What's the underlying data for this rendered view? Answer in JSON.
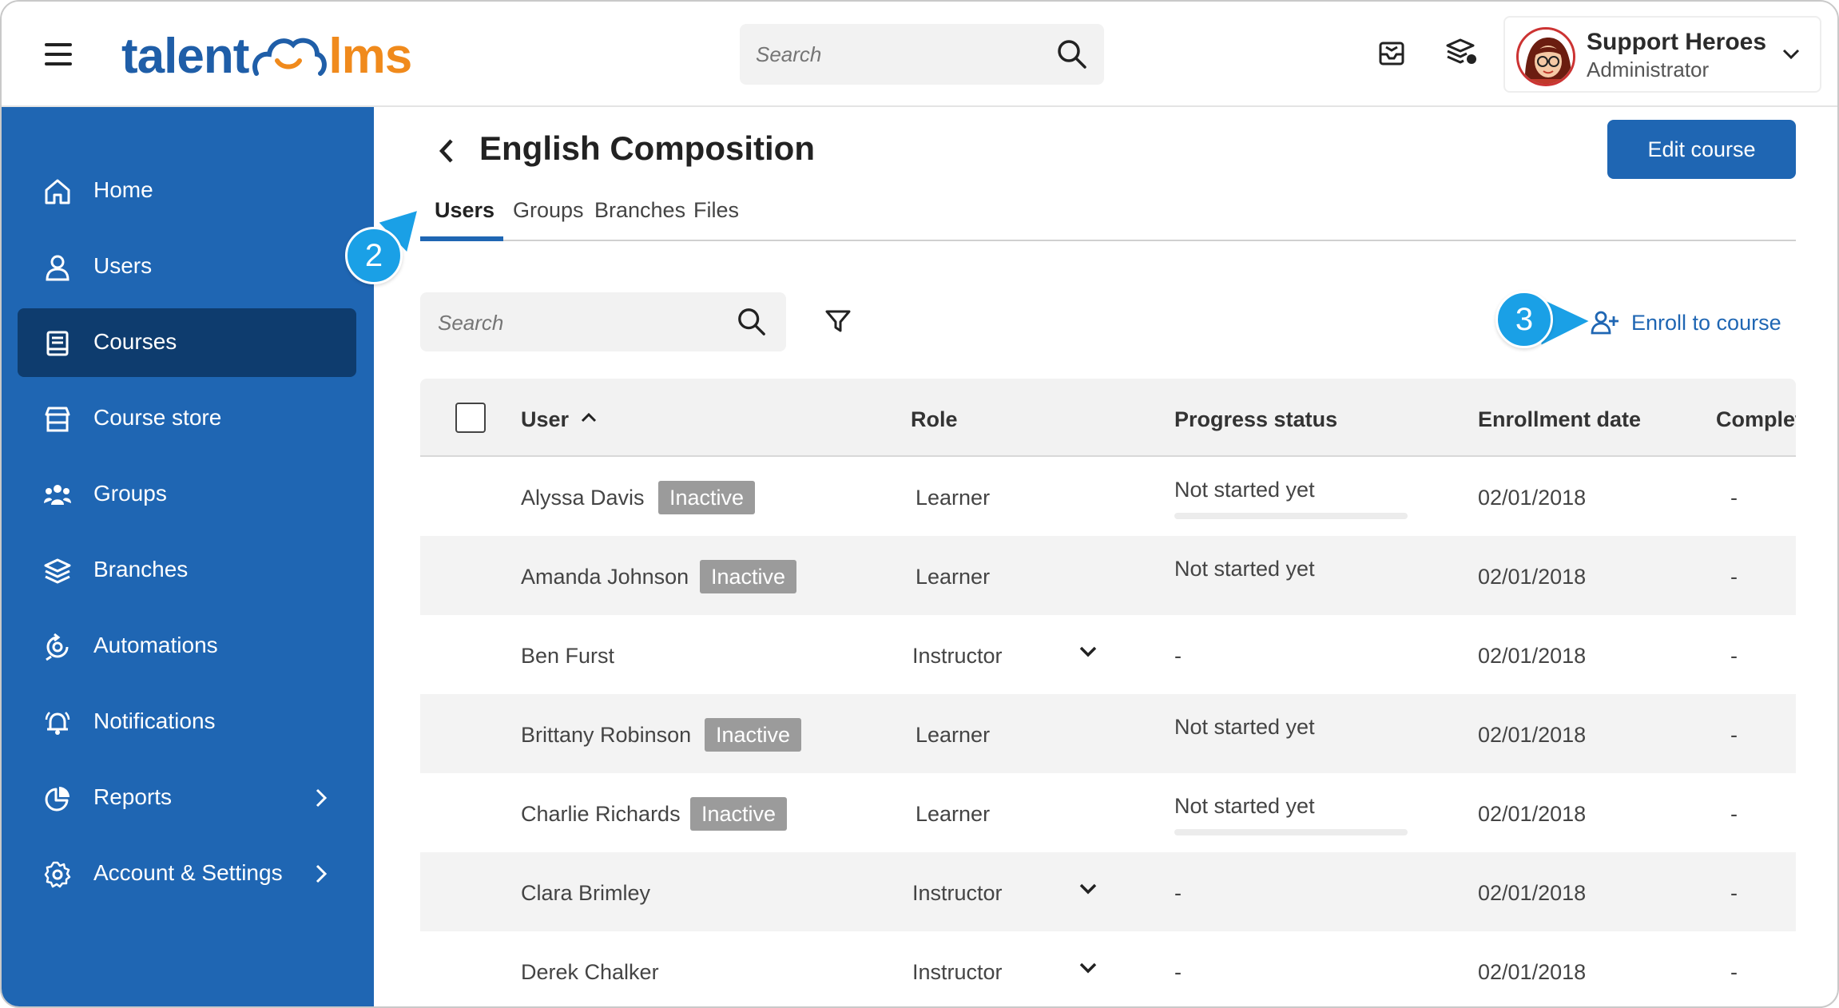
{
  "header": {
    "logo_left": "talent",
    "logo_right": "lms",
    "search_placeholder": "Search",
    "user_name": "Support Heroes",
    "user_role": "Administrator"
  },
  "sidebar": {
    "items": [
      {
        "label": "Home",
        "icon": "home-icon"
      },
      {
        "label": "Users",
        "icon": "user-icon"
      },
      {
        "label": "Courses",
        "icon": "book-icon",
        "active": true
      },
      {
        "label": "Course store",
        "icon": "store-icon"
      },
      {
        "label": "Groups",
        "icon": "groups-icon"
      },
      {
        "label": "Branches",
        "icon": "layers-icon"
      },
      {
        "label": "Automations",
        "icon": "automation-icon"
      },
      {
        "label": "Notifications",
        "icon": "bell-icon"
      },
      {
        "label": "Reports",
        "icon": "pie-chart-icon",
        "has_arrow": true
      },
      {
        "label": "Account & Settings",
        "icon": "gear-icon",
        "has_arrow": true
      }
    ]
  },
  "page": {
    "title": "English Composition",
    "edit_button": "Edit course",
    "tabs": [
      "Users",
      "Groups",
      "Branches",
      "Files"
    ],
    "active_tab": "Users",
    "search_placeholder": "Search",
    "enroll_label": "Enroll to course",
    "callouts": [
      "2",
      "3"
    ]
  },
  "table": {
    "columns": [
      "User",
      "Role",
      "Progress status",
      "Enrollment date",
      "Complet"
    ],
    "rows": [
      {
        "user": "Alyssa Davis",
        "badge": "Inactive",
        "role": "Learner",
        "progress": "Not started yet",
        "date": "02/01/2018",
        "completion": "-"
      },
      {
        "user": "Amanda Johnson",
        "badge": "Inactive",
        "role": "Learner",
        "progress": "Not started yet",
        "date": "02/01/2018",
        "completion": "-"
      },
      {
        "user": "Ben Furst",
        "badge": "",
        "role": "Instructor",
        "progress": "-",
        "date": "02/01/2018",
        "completion": "-"
      },
      {
        "user": "Brittany Robinson",
        "badge": "Inactive",
        "role": "Learner",
        "progress": "Not started yet",
        "date": "02/01/2018",
        "completion": "-"
      },
      {
        "user": "Charlie Richards",
        "badge": "Inactive",
        "role": "Learner",
        "progress": "Not started yet",
        "date": "02/01/2018",
        "completion": "-"
      },
      {
        "user": "Clara Brimley",
        "badge": "",
        "role": "Instructor",
        "progress": "-",
        "date": "02/01/2018",
        "completion": "-"
      },
      {
        "user": "Derek Chalker",
        "badge": "",
        "role": "Instructor",
        "progress": "-",
        "date": "02/01/2018",
        "completion": "-"
      }
    ]
  },
  "colors": {
    "brand_blue": "#1f66b3",
    "brand_orange": "#f08a1c",
    "sidebar_active": "#0e3c6e",
    "callout": "#1aa0e6",
    "badge_gray": "#9b9b9b"
  }
}
